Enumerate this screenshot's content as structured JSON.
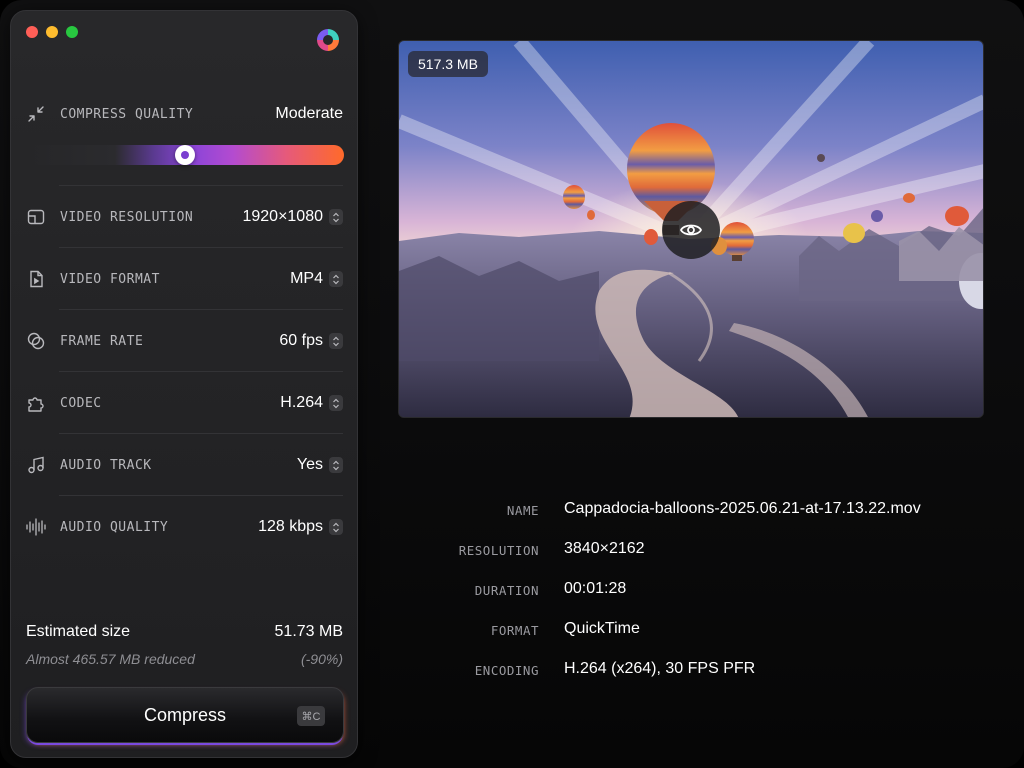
{
  "window": {
    "controls": [
      "close",
      "minimize",
      "zoom"
    ]
  },
  "app": {
    "logo": "app-logo-icon"
  },
  "compress_quality": {
    "label": "COMPRESS QUALITY",
    "value": "Moderate",
    "level": 0.5
  },
  "settings": [
    {
      "key": "resolution",
      "label": "VIDEO RESOLUTION",
      "value": "1920×1080",
      "icon": "resolution-icon"
    },
    {
      "key": "format",
      "label": "VIDEO FORMAT",
      "value": "MP4",
      "icon": "video-file-icon"
    },
    {
      "key": "framerate",
      "label": "FRAME RATE",
      "value": "60 fps",
      "icon": "frame-rate-icon"
    },
    {
      "key": "codec",
      "label": "CODEC",
      "value": "H.264",
      "icon": "puzzle-icon"
    },
    {
      "key": "audio_track",
      "label": "AUDIO TRACK",
      "value": "Yes",
      "icon": "music-note-icon"
    },
    {
      "key": "audio_quality",
      "label": "AUDIO QUALITY",
      "value": "128 kbps",
      "icon": "waveform-icon"
    }
  ],
  "estimate": {
    "label": "Estimated size",
    "value": "51.73 MB",
    "reduced_label": "Almost 465.57 MB reduced",
    "reduced_pct": "(-90%)"
  },
  "compress_button": {
    "label": "Compress",
    "shortcut": "⌘C"
  },
  "preview": {
    "size_badge": "517.3 MB"
  },
  "file_info": [
    {
      "key": "NAME",
      "value": "Cappadocia-balloons-2025.06.21-at-17.13.22.mov"
    },
    {
      "key": "RESOLUTION",
      "value": "3840×2162"
    },
    {
      "key": "DURATION",
      "value": "00:01:28"
    },
    {
      "key": "FORMAT",
      "value": "QuickTime"
    },
    {
      "key": "ENCODING",
      "value": "H.264 (x264), 30 FPS PFR"
    }
  ],
  "colors": {
    "accent_purple": "#8a45d8",
    "accent_orange": "#ff6a2a"
  }
}
